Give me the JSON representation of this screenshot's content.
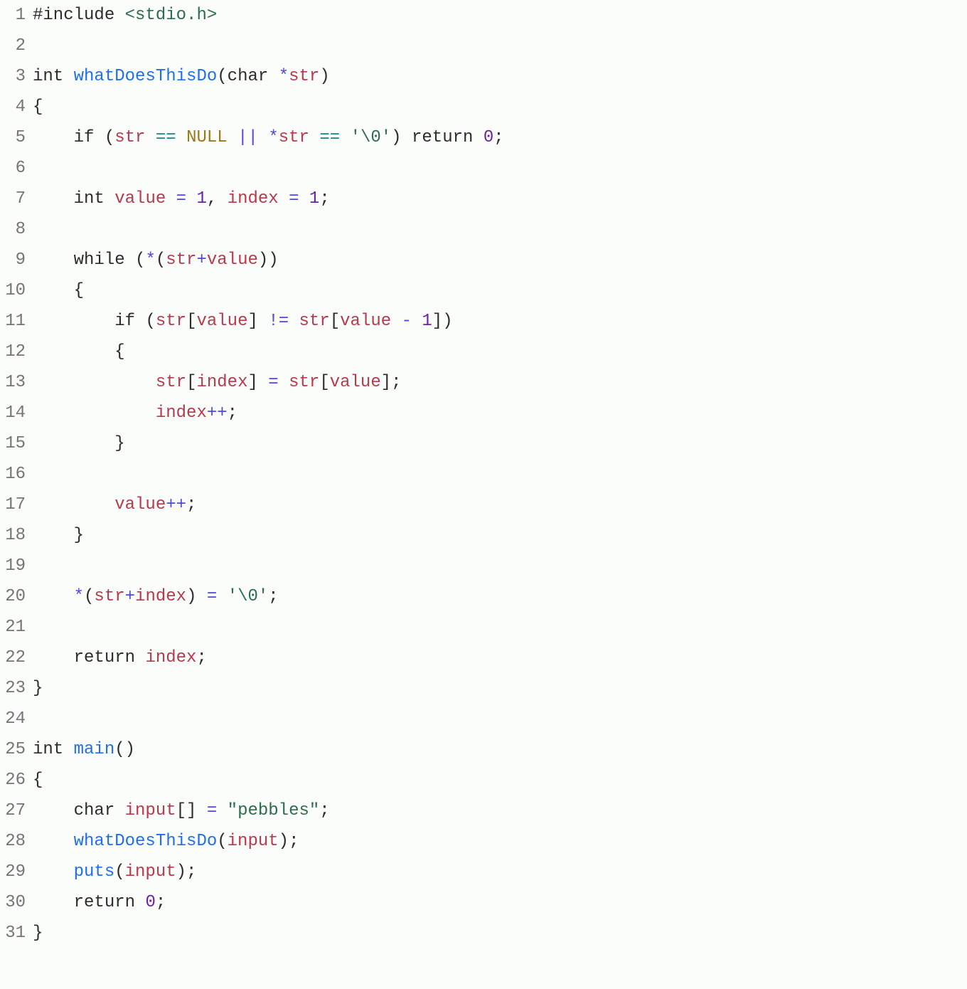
{
  "code": {
    "language": "c",
    "lines": [
      {
        "n": "1",
        "tokens": [
          {
            "c": "tok-pp",
            "t": "#include"
          },
          {
            "c": "",
            "t": " "
          },
          {
            "c": "tok-inc",
            "t": "<stdio.h>"
          }
        ]
      },
      {
        "n": "2",
        "tokens": []
      },
      {
        "n": "3",
        "tokens": [
          {
            "c": "tok-kw",
            "t": "int"
          },
          {
            "c": "",
            "t": " "
          },
          {
            "c": "tok-fn",
            "t": "whatDoesThisDo"
          },
          {
            "c": "tok-punc",
            "t": "("
          },
          {
            "c": "tok-kw",
            "t": "char"
          },
          {
            "c": "",
            "t": " "
          },
          {
            "c": "tok-op2",
            "t": "*"
          },
          {
            "c": "tok-var",
            "t": "str"
          },
          {
            "c": "tok-punc",
            "t": ")"
          }
        ]
      },
      {
        "n": "4",
        "tokens": [
          {
            "c": "tok-punc",
            "t": "{"
          }
        ]
      },
      {
        "n": "5",
        "tokens": [
          {
            "c": "",
            "t": "    "
          },
          {
            "c": "tok-kw",
            "t": "if"
          },
          {
            "c": "",
            "t": " "
          },
          {
            "c": "tok-punc",
            "t": "("
          },
          {
            "c": "tok-var",
            "t": "str"
          },
          {
            "c": "",
            "t": " "
          },
          {
            "c": "tok-op",
            "t": "=="
          },
          {
            "c": "",
            "t": " "
          },
          {
            "c": "tok-null",
            "t": "NULL"
          },
          {
            "c": "",
            "t": " "
          },
          {
            "c": "tok-op2",
            "t": "||"
          },
          {
            "c": "",
            "t": " "
          },
          {
            "c": "tok-op2",
            "t": "*"
          },
          {
            "c": "tok-var",
            "t": "str"
          },
          {
            "c": "",
            "t": " "
          },
          {
            "c": "tok-op",
            "t": "=="
          },
          {
            "c": "",
            "t": " "
          },
          {
            "c": "tok-str",
            "t": "'\\0'"
          },
          {
            "c": "tok-punc",
            "t": ")"
          },
          {
            "c": "",
            "t": " "
          },
          {
            "c": "tok-kw",
            "t": "return"
          },
          {
            "c": "",
            "t": " "
          },
          {
            "c": "tok-num",
            "t": "0"
          },
          {
            "c": "tok-punc",
            "t": ";"
          }
        ]
      },
      {
        "n": "6",
        "tokens": []
      },
      {
        "n": "7",
        "tokens": [
          {
            "c": "",
            "t": "    "
          },
          {
            "c": "tok-kw",
            "t": "int"
          },
          {
            "c": "",
            "t": " "
          },
          {
            "c": "tok-var",
            "t": "value"
          },
          {
            "c": "",
            "t": " "
          },
          {
            "c": "tok-op2",
            "t": "="
          },
          {
            "c": "",
            "t": " "
          },
          {
            "c": "tok-num",
            "t": "1"
          },
          {
            "c": "tok-punc",
            "t": ","
          },
          {
            "c": "",
            "t": " "
          },
          {
            "c": "tok-var",
            "t": "index"
          },
          {
            "c": "",
            "t": " "
          },
          {
            "c": "tok-op2",
            "t": "="
          },
          {
            "c": "",
            "t": " "
          },
          {
            "c": "tok-num",
            "t": "1"
          },
          {
            "c": "tok-punc",
            "t": ";"
          }
        ]
      },
      {
        "n": "8",
        "tokens": []
      },
      {
        "n": "9",
        "tokens": [
          {
            "c": "",
            "t": "    "
          },
          {
            "c": "tok-kw",
            "t": "while"
          },
          {
            "c": "",
            "t": " "
          },
          {
            "c": "tok-punc",
            "t": "("
          },
          {
            "c": "tok-op2",
            "t": "*"
          },
          {
            "c": "tok-punc",
            "t": "("
          },
          {
            "c": "tok-var",
            "t": "str"
          },
          {
            "c": "tok-op2",
            "t": "+"
          },
          {
            "c": "tok-var",
            "t": "value"
          },
          {
            "c": "tok-punc",
            "t": ")"
          },
          {
            "c": "tok-punc",
            "t": ")"
          }
        ]
      },
      {
        "n": "10",
        "tokens": [
          {
            "c": "",
            "t": "    "
          },
          {
            "c": "tok-punc",
            "t": "{"
          }
        ]
      },
      {
        "n": "11",
        "tokens": [
          {
            "c": "",
            "t": "        "
          },
          {
            "c": "tok-kw",
            "t": "if"
          },
          {
            "c": "",
            "t": " "
          },
          {
            "c": "tok-punc",
            "t": "("
          },
          {
            "c": "tok-var",
            "t": "str"
          },
          {
            "c": "tok-punc",
            "t": "["
          },
          {
            "c": "tok-var",
            "t": "value"
          },
          {
            "c": "tok-punc",
            "t": "]"
          },
          {
            "c": "",
            "t": " "
          },
          {
            "c": "tok-op2",
            "t": "!="
          },
          {
            "c": "",
            "t": " "
          },
          {
            "c": "tok-var",
            "t": "str"
          },
          {
            "c": "tok-punc",
            "t": "["
          },
          {
            "c": "tok-var",
            "t": "value"
          },
          {
            "c": "",
            "t": " "
          },
          {
            "c": "tok-op2",
            "t": "-"
          },
          {
            "c": "",
            "t": " "
          },
          {
            "c": "tok-num",
            "t": "1"
          },
          {
            "c": "tok-punc",
            "t": "]"
          },
          {
            "c": "tok-punc",
            "t": ")"
          }
        ]
      },
      {
        "n": "12",
        "tokens": [
          {
            "c": "",
            "t": "        "
          },
          {
            "c": "tok-punc",
            "t": "{"
          }
        ]
      },
      {
        "n": "13",
        "tokens": [
          {
            "c": "",
            "t": "            "
          },
          {
            "c": "tok-var",
            "t": "str"
          },
          {
            "c": "tok-punc",
            "t": "["
          },
          {
            "c": "tok-var",
            "t": "index"
          },
          {
            "c": "tok-punc",
            "t": "]"
          },
          {
            "c": "",
            "t": " "
          },
          {
            "c": "tok-op2",
            "t": "="
          },
          {
            "c": "",
            "t": " "
          },
          {
            "c": "tok-var",
            "t": "str"
          },
          {
            "c": "tok-punc",
            "t": "["
          },
          {
            "c": "tok-var",
            "t": "value"
          },
          {
            "c": "tok-punc",
            "t": "]"
          },
          {
            "c": "tok-punc",
            "t": ";"
          }
        ]
      },
      {
        "n": "14",
        "tokens": [
          {
            "c": "",
            "t": "            "
          },
          {
            "c": "tok-var",
            "t": "index"
          },
          {
            "c": "tok-op2",
            "t": "++"
          },
          {
            "c": "tok-punc",
            "t": ";"
          }
        ]
      },
      {
        "n": "15",
        "tokens": [
          {
            "c": "",
            "t": "        "
          },
          {
            "c": "tok-punc",
            "t": "}"
          }
        ]
      },
      {
        "n": "16",
        "tokens": []
      },
      {
        "n": "17",
        "tokens": [
          {
            "c": "",
            "t": "        "
          },
          {
            "c": "tok-var",
            "t": "value"
          },
          {
            "c": "tok-op2",
            "t": "++"
          },
          {
            "c": "tok-punc",
            "t": ";"
          }
        ]
      },
      {
        "n": "18",
        "tokens": [
          {
            "c": "",
            "t": "    "
          },
          {
            "c": "tok-punc",
            "t": "}"
          }
        ]
      },
      {
        "n": "19",
        "tokens": []
      },
      {
        "n": "20",
        "tokens": [
          {
            "c": "",
            "t": "    "
          },
          {
            "c": "tok-op2",
            "t": "*"
          },
          {
            "c": "tok-punc",
            "t": "("
          },
          {
            "c": "tok-var",
            "t": "str"
          },
          {
            "c": "tok-op2",
            "t": "+"
          },
          {
            "c": "tok-var",
            "t": "index"
          },
          {
            "c": "tok-punc",
            "t": ")"
          },
          {
            "c": "",
            "t": " "
          },
          {
            "c": "tok-op2",
            "t": "="
          },
          {
            "c": "",
            "t": " "
          },
          {
            "c": "tok-str",
            "t": "'\\0'"
          },
          {
            "c": "tok-punc",
            "t": ";"
          }
        ]
      },
      {
        "n": "21",
        "tokens": []
      },
      {
        "n": "22",
        "tokens": [
          {
            "c": "",
            "t": "    "
          },
          {
            "c": "tok-kw",
            "t": "return"
          },
          {
            "c": "",
            "t": " "
          },
          {
            "c": "tok-var",
            "t": "index"
          },
          {
            "c": "tok-punc",
            "t": ";"
          }
        ]
      },
      {
        "n": "23",
        "tokens": [
          {
            "c": "tok-punc",
            "t": "}"
          }
        ]
      },
      {
        "n": "24",
        "tokens": []
      },
      {
        "n": "25",
        "tokens": [
          {
            "c": "tok-kw",
            "t": "int"
          },
          {
            "c": "",
            "t": " "
          },
          {
            "c": "tok-fn",
            "t": "main"
          },
          {
            "c": "tok-punc",
            "t": "()"
          }
        ]
      },
      {
        "n": "26",
        "tokens": [
          {
            "c": "tok-punc",
            "t": "{"
          }
        ]
      },
      {
        "n": "27",
        "tokens": [
          {
            "c": "",
            "t": "    "
          },
          {
            "c": "tok-kw",
            "t": "char"
          },
          {
            "c": "",
            "t": " "
          },
          {
            "c": "tok-var",
            "t": "input"
          },
          {
            "c": "tok-punc",
            "t": "[]"
          },
          {
            "c": "",
            "t": " "
          },
          {
            "c": "tok-op2",
            "t": "="
          },
          {
            "c": "",
            "t": " "
          },
          {
            "c": "tok-str",
            "t": "\"pebbles\""
          },
          {
            "c": "tok-punc",
            "t": ";"
          }
        ]
      },
      {
        "n": "28",
        "tokens": [
          {
            "c": "",
            "t": "    "
          },
          {
            "c": "tok-fn",
            "t": "whatDoesThisDo"
          },
          {
            "c": "tok-punc",
            "t": "("
          },
          {
            "c": "tok-var",
            "t": "input"
          },
          {
            "c": "tok-punc",
            "t": ")"
          },
          {
            "c": "tok-punc",
            "t": ";"
          }
        ]
      },
      {
        "n": "29",
        "tokens": [
          {
            "c": "",
            "t": "    "
          },
          {
            "c": "tok-fn",
            "t": "puts"
          },
          {
            "c": "tok-punc",
            "t": "("
          },
          {
            "c": "tok-var",
            "t": "input"
          },
          {
            "c": "tok-punc",
            "t": ")"
          },
          {
            "c": "tok-punc",
            "t": ";"
          }
        ]
      },
      {
        "n": "30",
        "tokens": [
          {
            "c": "",
            "t": "    "
          },
          {
            "c": "tok-kw",
            "t": "return"
          },
          {
            "c": "",
            "t": " "
          },
          {
            "c": "tok-num",
            "t": "0"
          },
          {
            "c": "tok-punc",
            "t": ";"
          }
        ]
      },
      {
        "n": "31",
        "tokens": [
          {
            "c": "tok-punc",
            "t": "}"
          }
        ]
      }
    ]
  }
}
